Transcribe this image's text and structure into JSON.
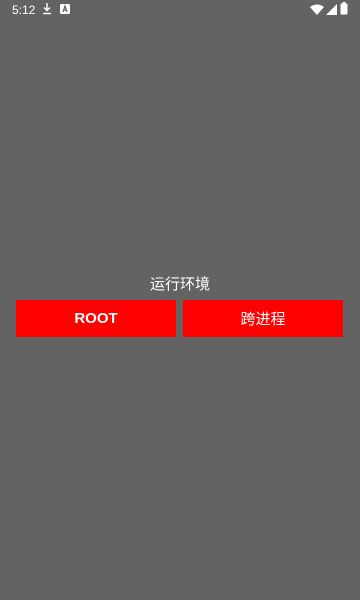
{
  "status_bar": {
    "time": "5:12",
    "icons": [
      "download-icon",
      "a-icon",
      "wifi-icon",
      "signal-icon",
      "battery-icon"
    ]
  },
  "main": {
    "env_label": "运行环境",
    "buttons": {
      "root_label": "ROOT",
      "cross_process_label": "跨进程"
    }
  },
  "colors": {
    "background": "#636363",
    "button": "#ff0000",
    "text": "#ffffff"
  }
}
